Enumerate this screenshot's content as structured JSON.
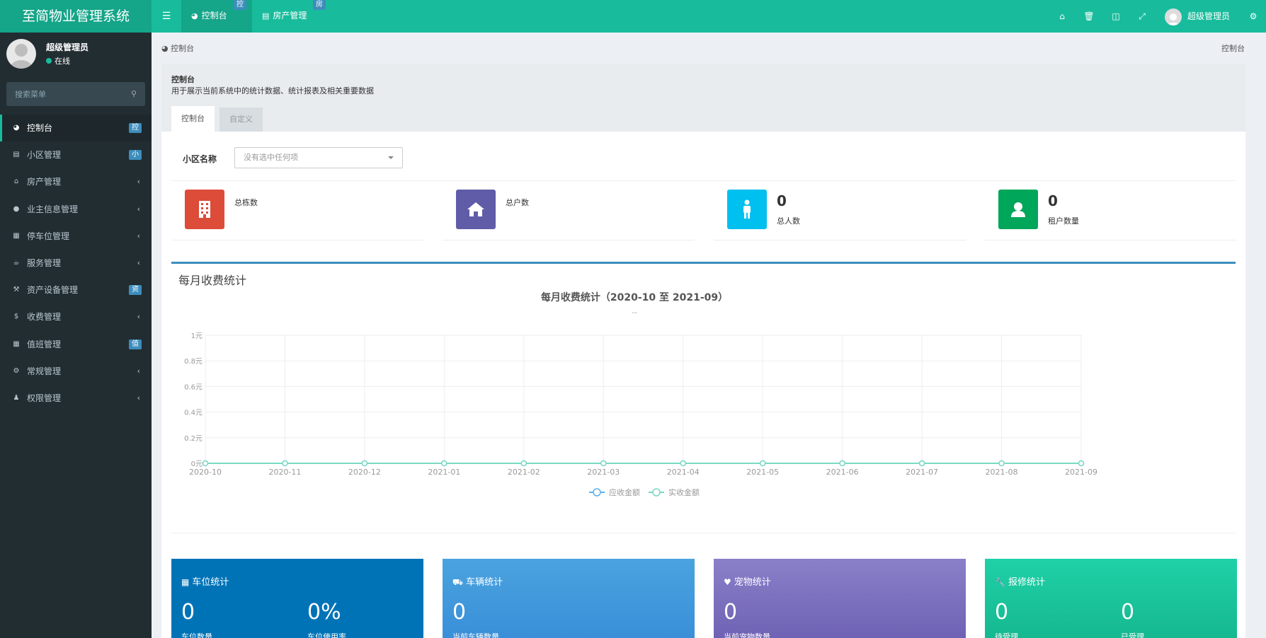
{
  "app": {
    "title": "至简物业管理系统"
  },
  "topbar": {
    "tabs": [
      {
        "label": "控制台",
        "badge": "控"
      },
      {
        "label": "房产管理",
        "badge": "房"
      }
    ],
    "user": "超级管理员"
  },
  "sidebar": {
    "user": {
      "name": "超级管理员",
      "status": "在线"
    },
    "search_placeholder": "搜索菜单",
    "items": [
      {
        "label": "控制台",
        "badge": "控"
      },
      {
        "label": "小区管理",
        "badge": "小"
      },
      {
        "label": "房产管理"
      },
      {
        "label": "业主信息管理"
      },
      {
        "label": "停车位管理"
      },
      {
        "label": "服务管理"
      },
      {
        "label": "资产设备管理",
        "badge": "资"
      },
      {
        "label": "收费管理"
      },
      {
        "label": "值班管理",
        "badge": "值"
      },
      {
        "label": "常规管理"
      },
      {
        "label": "权限管理"
      }
    ]
  },
  "breadcrumb": {
    "left": "控制台",
    "right": "控制台"
  },
  "panel": {
    "title": "控制台",
    "desc": "用于展示当前系统中的统计数据、统计报表及相关重要数据",
    "tabs": [
      "控制台",
      "自定义"
    ]
  },
  "filter": {
    "label": "小区名称",
    "placeholder": "没有选中任何项"
  },
  "stats": [
    {
      "label": "总栋数",
      "value": "",
      "color": "#dd4b39"
    },
    {
      "label": "总户数",
      "value": "",
      "color": "#605ca8"
    },
    {
      "label": "总人数",
      "value": "0",
      "color": "#00c0ef"
    },
    {
      "label": "租户数量",
      "value": "0",
      "color": "#00a65a"
    }
  ],
  "chart_box_title": "每月收费统计",
  "chart_data": {
    "type": "line",
    "title": "每月收费统计（2020-10 至 2021-09）",
    "subtitle": "--",
    "categories": [
      "2020-10",
      "2020-11",
      "2020-12",
      "2021-01",
      "2021-02",
      "2021-03",
      "2021-04",
      "2021-05",
      "2021-06",
      "2021-07",
      "2021-08",
      "2021-09"
    ],
    "y_ticks": [
      "0元",
      "0.2元",
      "0.4元",
      "0.6元",
      "0.8元",
      "1元"
    ],
    "ylim": [
      0,
      1
    ],
    "series": [
      {
        "name": "应收金额",
        "values": [
          0,
          0,
          0,
          0,
          0,
          0,
          0,
          0,
          0,
          0,
          0,
          0
        ],
        "color": "#5ab1ef"
      },
      {
        "name": "实收金额",
        "values": [
          0,
          0,
          0,
          0,
          0,
          0,
          0,
          0,
          0,
          0,
          0,
          0
        ],
        "color": "#7ad9c4"
      }
    ],
    "grid": true,
    "legend": "bottom-center"
  },
  "info_cards": [
    {
      "title": "车位统计",
      "v1": "0",
      "l1": "车位数量",
      "v2": "0%",
      "l2": "车位使用率",
      "color": "#0073b7"
    },
    {
      "title": "车辆统计",
      "v1": "0",
      "l1": "当前车辆数量",
      "color": "#4aa3df"
    },
    {
      "title": "宠物统计",
      "v1": "0",
      "l1": "当前宠物数量",
      "color": "#7e6fbf"
    },
    {
      "title": "报修统计",
      "v1": "0",
      "l1": "待受理",
      "v2": "0",
      "l2": "已受理",
      "color": "#1fd1a7"
    }
  ]
}
